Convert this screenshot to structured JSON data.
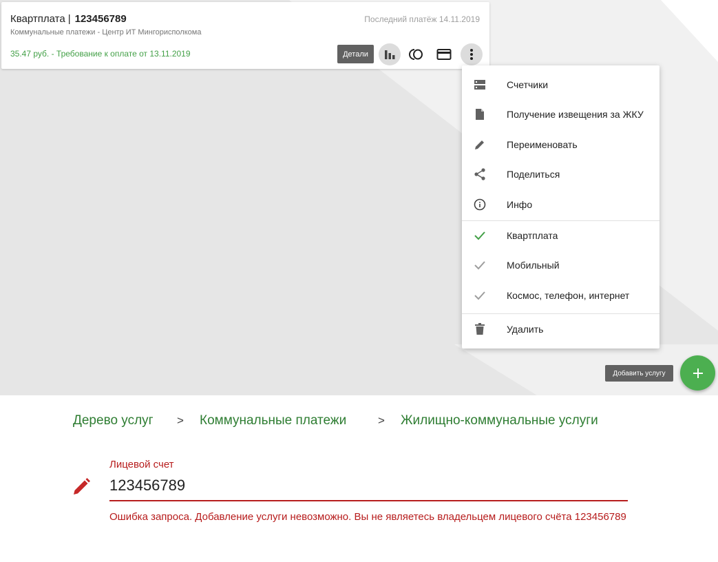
{
  "card": {
    "title": "Квартплата",
    "title_separator": "|",
    "account": "123456789",
    "provider": "Коммунальные платежи - Центр ИТ Мингорисполкома",
    "last_payment": "Последний платёж 14.11.2019",
    "due": "35.47 руб. - Требование к оплате от 13.11.2019",
    "details_label": "Детали",
    "icons": [
      "bar-chart-icon",
      "ring-icon",
      "credit-card-icon",
      "more-vert-icon"
    ]
  },
  "menu": {
    "items": [
      {
        "label": "Счетчики",
        "icon": "meters-icon"
      },
      {
        "label": "Получение извещения за ЖКУ",
        "icon": "document-icon"
      },
      {
        "label": "Переименовать",
        "icon": "pencil-icon"
      },
      {
        "label": "Поделиться",
        "icon": "share-icon"
      },
      {
        "label": "Инфо",
        "icon": "info-icon"
      }
    ],
    "lists": [
      {
        "label": "Квартплата",
        "icon": "check-icon",
        "color": "#43a047"
      },
      {
        "label": "Мобильный",
        "icon": "check-icon",
        "color": "#9e9e9e"
      },
      {
        "label": "Космос, телефон, интернет",
        "icon": "check-icon",
        "color": "#9e9e9e"
      }
    ],
    "delete_label": "Удалить"
  },
  "add_service": {
    "tooltip": "Добавить услугу",
    "icon": "plus-icon"
  },
  "breadcrumb": {
    "items": [
      "Дерево услуг",
      "Коммунальные платежи",
      "Жилищно-коммунальные услуги"
    ],
    "separator": ">"
  },
  "account_field": {
    "label": "Лицевой счет",
    "value": "123456789",
    "error": "Ошибка запроса. Добавление услуги невозможно. Вы не являетесь владельцем лицевого счёта  123456789"
  },
  "colors": {
    "accent_green": "#43a047",
    "error_red": "#b71c1c",
    "fab_green": "#4caf50"
  }
}
